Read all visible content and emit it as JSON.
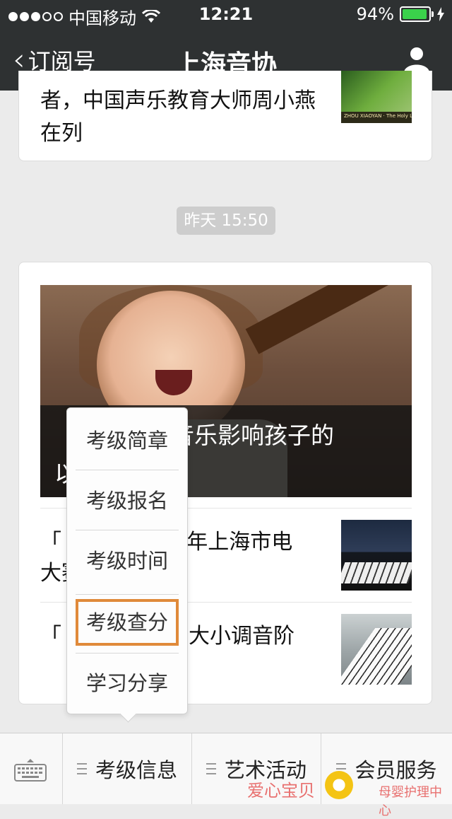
{
  "status_bar": {
    "carrier": "中国移动",
    "time": "12:21",
    "battery": "94%",
    "battery_level": 0.94
  },
  "nav": {
    "back_label": "订阅号",
    "title": "上海音协"
  },
  "feed": {
    "article_prev": {
      "title": "者，中国声乐教育大师周小燕在列",
      "thumb_caption": "ZHOU XIAOYAN · The Holy Lily of Chinese Opera"
    },
    "timestamp": "昨天 15:50",
    "main_article": {
      "caption": "「　　　」音乐影响孩子的　　　　以！"
    },
    "list": [
      {
        "title": "「　　　　017年上海市电　　　大赛比赛简章"
      },
      {
        "title": "「　　　　常用大小调音阶　"
      }
    ]
  },
  "popup_menu": {
    "items": [
      {
        "label": "考级简章"
      },
      {
        "label": "考级报名"
      },
      {
        "label": "考级时间"
      },
      {
        "label": "考级查分",
        "highlighted": true
      },
      {
        "label": "学习分享"
      }
    ]
  },
  "bottom_menu": {
    "tabs": [
      {
        "label": "考级信息"
      },
      {
        "label": "艺术活动"
      },
      {
        "label": "会员服务"
      }
    ]
  },
  "watermark": {
    "text_left": "爱心宝贝",
    "text_small": "",
    "text_right": "母婴护理中心"
  },
  "colors": {
    "nav_bg": "#2e3132",
    "highlight_border": "#e08a3a",
    "battery_green": "#3ad24b",
    "page_bg": "#ebebeb"
  }
}
